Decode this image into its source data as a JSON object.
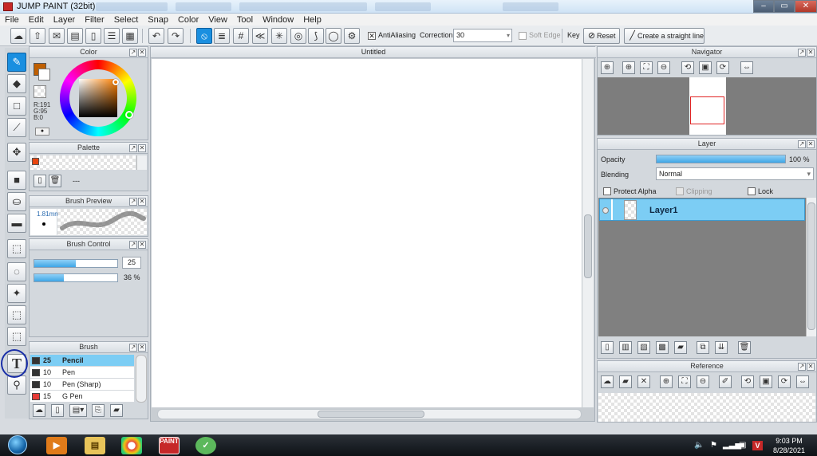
{
  "window": {
    "title": "JUMP PAINT (32bit)",
    "min": "–",
    "max": "▭",
    "close": "✕"
  },
  "menu": [
    "File",
    "Edit",
    "Layer",
    "Filter",
    "Select",
    "Snap",
    "Color",
    "View",
    "Tool",
    "Window",
    "Help"
  ],
  "toolbar": {
    "antialiasing_label": "AntiAliasing",
    "correction_label": "Correction",
    "correction_value": "30",
    "soft_edge_label": "Soft Edge",
    "key_label": "Key",
    "reset_label": "Reset",
    "straight_line_label": "Create a straight line"
  },
  "color_panel": {
    "title": "Color",
    "r": "R:191",
    "g": "G:95",
    "b": "B:0",
    "main_color": "#bf5f00"
  },
  "palette_panel": {
    "title": "Palette",
    "placeholder": "---"
  },
  "brush_preview_panel": {
    "title": "Brush Preview",
    "size": "1.81mm"
  },
  "brush_control_panel": {
    "title": "Brush Control",
    "size_value": "25",
    "opacity_value": "36 %",
    "size_fraction": 0.5,
    "opacity_fraction": 0.36
  },
  "brush_panel": {
    "title": "Brush",
    "items": [
      {
        "size": "25",
        "name": "Pencil",
        "color": "#333333",
        "selected": true
      },
      {
        "size": "10",
        "name": "Pen",
        "color": "#333333",
        "selected": false
      },
      {
        "size": "10",
        "name": "Pen (Sharp)",
        "color": "#333333",
        "selected": false
      },
      {
        "size": "15",
        "name": "G Pen",
        "color": "#e53935",
        "selected": false
      }
    ]
  },
  "canvas": {
    "tab": "Untitled"
  },
  "navigator_panel": {
    "title": "Navigator"
  },
  "layer_panel": {
    "title": "Layer",
    "opacity_label": "Opacity",
    "opacity_value": "100 %",
    "opacity_fraction": 1.0,
    "blending_label": "Blending",
    "blending_value": "Normal",
    "protect_alpha_label": "Protect Alpha",
    "clipping_label": "Clipping",
    "lock_label": "Lock",
    "layers": [
      {
        "name": "Layer1"
      }
    ]
  },
  "reference_panel": {
    "title": "Reference"
  },
  "taskbar": {
    "time": "9:03 PM",
    "date": "8/28/2021",
    "paint_label": "PAINT"
  },
  "colors": {
    "accent": "#1a8fe0",
    "selection": "#7ccdf4"
  }
}
